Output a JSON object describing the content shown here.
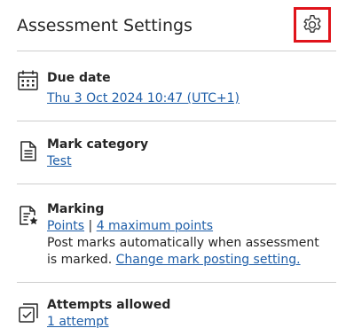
{
  "header": {
    "title": "Assessment Settings",
    "settings_icon": "gear-icon"
  },
  "due_date": {
    "label": "Due date",
    "value": "Thu 3 Oct 2024 10:47 (UTC+1)",
    "icon": "calendar-icon"
  },
  "mark_category": {
    "label": "Mark category",
    "value": "Test",
    "icon": "document-icon"
  },
  "marking": {
    "label": "Marking",
    "schema": "Points",
    "separator": "|",
    "max_points": "4 maximum points",
    "description": "Post marks automatically when assessment is marked.",
    "change_link": "Change mark posting setting.",
    "icon": "marking-icon"
  },
  "attempts": {
    "label": "Attempts allowed",
    "value": "1 attempt",
    "icon": "attempts-icon"
  },
  "colors": {
    "link": "#1e5ea8",
    "highlight_border": "#e0141b",
    "divider": "#cdcdcd",
    "text": "#262626"
  }
}
